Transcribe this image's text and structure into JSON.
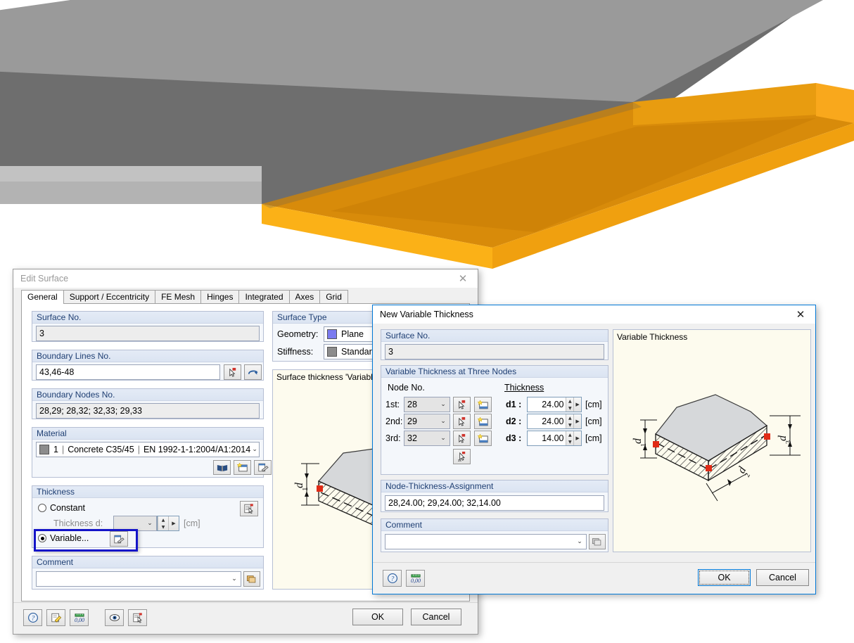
{
  "scene": {
    "name": "3d-surface-render",
    "colors": {
      "grey_top": "#6e6e6e",
      "grey_edge": "#a0a0a0",
      "orange_top": "#d78a0a",
      "orange_edge": "#f7a81b",
      "orange_side": "#fbb117"
    }
  },
  "edit_surface": {
    "title": "Edit Surface",
    "close_icon": "✕",
    "tabs": [
      {
        "label": "General",
        "active": true
      },
      {
        "label": "Support / Eccentricity",
        "active": false
      },
      {
        "label": "FE Mesh",
        "active": false
      },
      {
        "label": "Hinges",
        "active": false
      },
      {
        "label": "Integrated",
        "active": false
      },
      {
        "label": "Axes",
        "active": false
      },
      {
        "label": "Grid",
        "active": false
      }
    ],
    "surface_no": {
      "caption": "Surface No.",
      "value": "3"
    },
    "boundary_lines": {
      "caption": "Boundary Lines No.",
      "value": "43,46-48"
    },
    "boundary_nodes": {
      "caption": "Boundary Nodes No.",
      "value": "28,29; 28,32; 32,33; 29,33"
    },
    "material": {
      "caption": "Material",
      "number": "1",
      "name": "Concrete C35/45",
      "standard": "EN 1992-1-1:2004/A1:2014",
      "swatch_color": "#8c8c8c",
      "arrow": "⌄"
    },
    "thickness": {
      "caption": "Thickness",
      "constant_label": "Constant",
      "constant_selected": false,
      "thickness_d_label": "Thickness d:",
      "thickness_d_value": "",
      "unit": "[cm]",
      "variable_label": "Variable...",
      "variable_selected": true
    },
    "comment": {
      "caption": "Comment",
      "value": "",
      "arrow": "⌄"
    },
    "surface_type": {
      "caption": "Surface Type",
      "geometry_label": "Geometry:",
      "geometry_value": "Plane",
      "geometry_color": "#7b7bf0",
      "stiffness_label": "Stiffness:",
      "stiffness_value": "Standard",
      "stiffness_color": "#8c8c8c"
    },
    "preview": {
      "title": "Surface thickness 'Variable'",
      "dim_labels": [
        "d1"
      ]
    },
    "footer": {
      "ok": "OK",
      "cancel": "Cancel",
      "icons": [
        "help-icon",
        "edit-icon",
        "units-icon",
        "view-icon",
        "pick-icon"
      ]
    }
  },
  "new_variable_thickness": {
    "title": "New Variable Thickness",
    "close_icon": "✕",
    "surface_no": {
      "caption": "Surface No.",
      "value": "3"
    },
    "three_nodes": {
      "caption": "Variable Thickness at Three Nodes",
      "node_header": "Node No.",
      "thickness_header": "Thickness",
      "unit": "[cm]",
      "rows": [
        {
          "ord": "1st:",
          "node": "28",
          "d_label": "d1",
          "d_value": "24.00"
        },
        {
          "ord": "2nd:",
          "node": "29",
          "d_label": "d2",
          "d_value": "24.00"
        },
        {
          "ord": "3rd:",
          "node": "32",
          "d_label": "d3",
          "d_value": "14.00"
        }
      ]
    },
    "assignment": {
      "caption": "Node-Thickness-Assignment",
      "value": "28,24.00; 29,24.00; 32,14.00"
    },
    "comment": {
      "caption": "Comment",
      "value": "",
      "arrow": "⌄"
    },
    "preview": {
      "title": "Variable Thickness",
      "dim_labels": [
        "d1",
        "d2",
        "d3"
      ]
    },
    "footer": {
      "ok": "OK",
      "cancel": "Cancel",
      "icons": [
        "help-icon",
        "units-icon"
      ]
    }
  }
}
